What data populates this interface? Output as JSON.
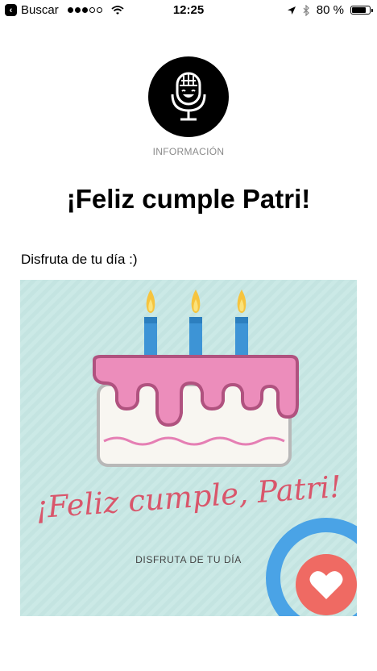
{
  "status_bar": {
    "back_label": "Buscar",
    "time": "12:25",
    "battery_percent": "80 %",
    "battery_level": 0.8,
    "signal_bars_filled": 3,
    "signal_bars_total": 5
  },
  "header": {
    "logo_icon": "microphone-icon",
    "section_label": "INFORMACIÓN"
  },
  "main": {
    "title": "¡Feliz cumple Patri!",
    "subtitle": "Disfruta de tu día :)"
  },
  "card": {
    "title": "¡Feliz cumple, Patri!",
    "subtitle": "DISFRUTA DE TU DÍA",
    "candle_count": 3,
    "colors": {
      "background": "#cbe9e6",
      "frosting": "#ec8dbb",
      "frosting_outline": "#b0527f",
      "cake_body": "#f8f6f1",
      "text_accent": "#d9566b",
      "ring": "#4aa3e6",
      "heart_circle": "#ef6a63"
    },
    "icons": [
      "candle-icon",
      "heart-icon"
    ]
  }
}
